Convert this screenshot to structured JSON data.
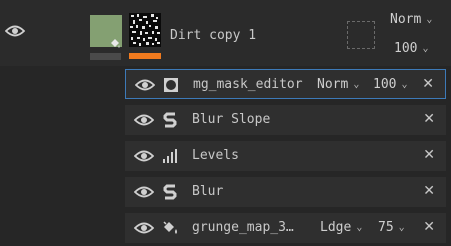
{
  "layer": {
    "name": "Dirt copy 1",
    "blend_mode": "Norm",
    "opacity": "100",
    "accent_bar_color": "#f07a1e",
    "fill_color": "#84a072"
  },
  "effects": [
    {
      "name": "mg_mask_editor",
      "icon": "circle-square-icon",
      "blend_mode": "Norm",
      "opacity": "100",
      "selected": true
    },
    {
      "name": "Blur Slope",
      "icon": "substance-s-icon"
    },
    {
      "name": "Levels",
      "icon": "levels-bars-icon"
    },
    {
      "name": "Blur",
      "icon": "substance-s-icon"
    },
    {
      "name": "grunge_map_3…",
      "icon": "paint-bucket-icon",
      "blend_mode": "Ldge",
      "opacity": "75"
    }
  ],
  "close_glyph": "✕",
  "colors": {
    "selection_border": "#3d7ab8",
    "background": "#262626",
    "row": "#2f2f2f"
  }
}
